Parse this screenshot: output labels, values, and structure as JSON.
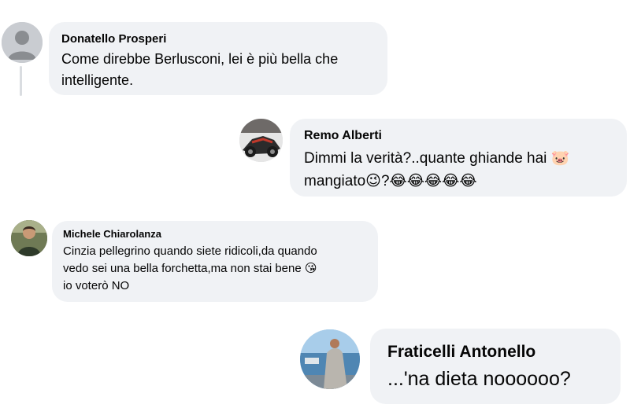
{
  "comments": [
    {
      "author": "Donatello Prosperi",
      "text": "Come direbbe Berlusconi, lei è più bella che\nintelligente.",
      "avatar_icon": "default-profile-icon"
    },
    {
      "author": "Remo Alberti",
      "text": "Dimmi la verità?..quante ghiande hai 🐷\nmangiato😉?😂😂😂😂😂",
      "avatar_icon": "motorcycle-photo"
    },
    {
      "author": "Michele Chiarolanza",
      "text": "Cinzia pellegrino quando siete ridicoli,da quando\nvedo sei una bella forchetta,ma non stai bene 😘\nio voterò NO",
      "avatar_icon": "person-photo"
    },
    {
      "author": "Fraticelli Antonello",
      "text": "...'na dieta noooooo?",
      "avatar_icon": "seaside-photo"
    }
  ],
  "colors": {
    "bubble": "#f0f2f5",
    "text": "#050505",
    "thread_line": "#dadde1"
  }
}
